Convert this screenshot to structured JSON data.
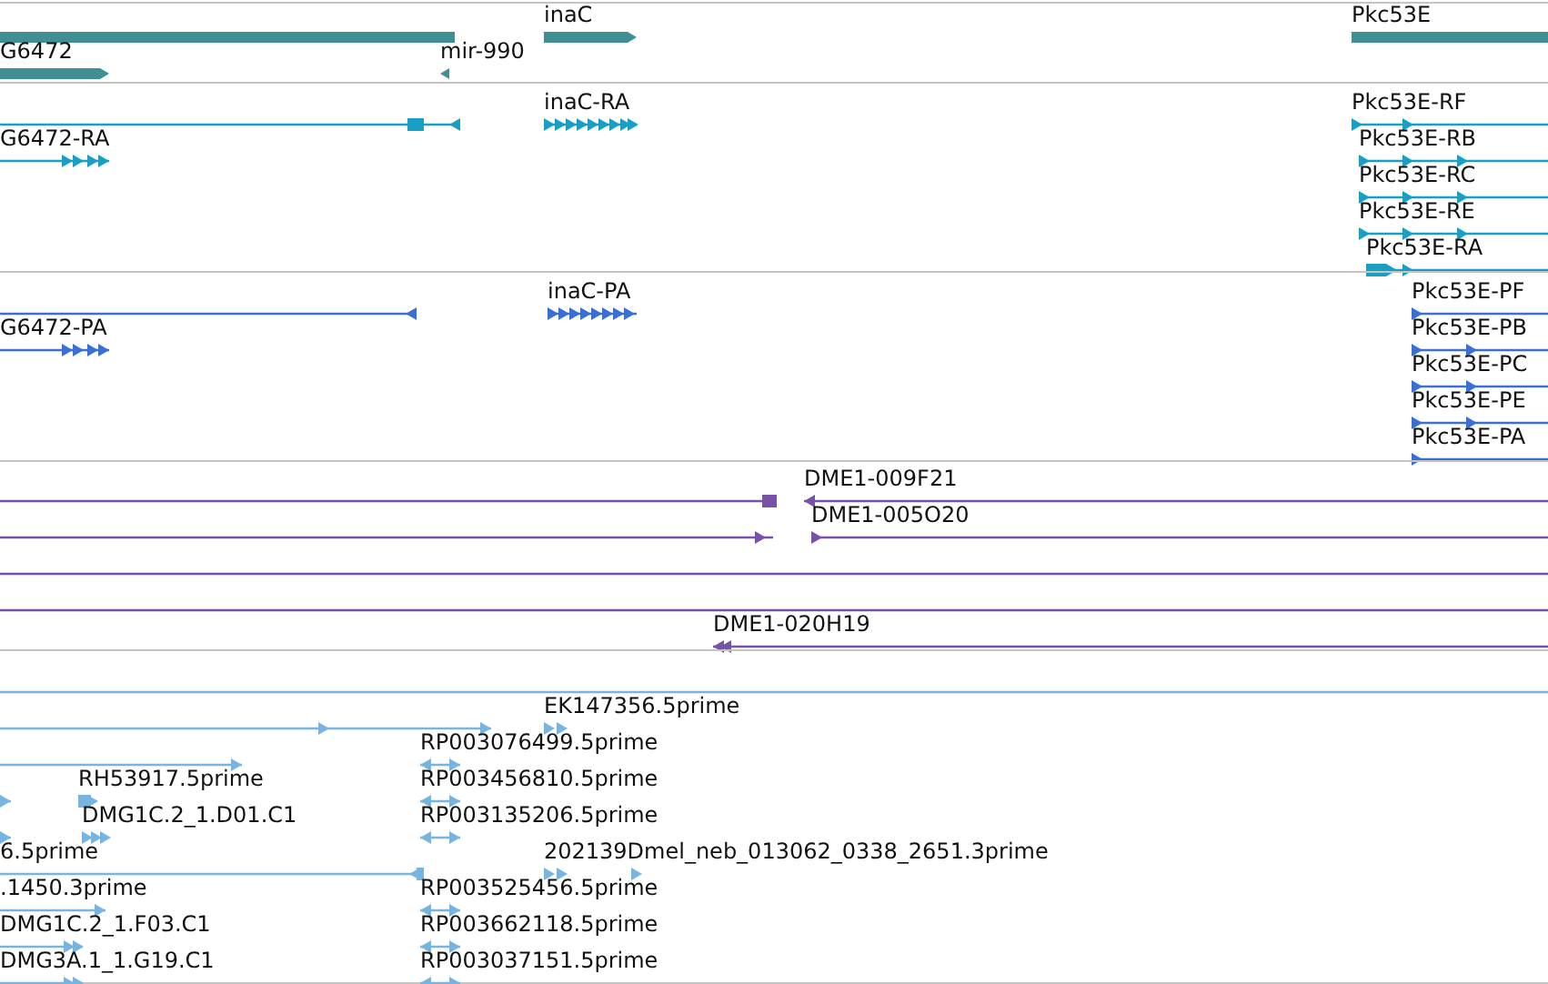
{
  "tracks": [
    {
      "kind": "gene",
      "color": "#3f8f93",
      "features": [
        {
          "reverse": true
        },
        {
          "label": "G6472",
          "reverse": false
        },
        {
          "label": "inaC",
          "reverse": false
        },
        {
          "label": "mir-990",
          "reverse": true
        },
        {
          "label": "Pkc53E",
          "reverse": false
        }
      ]
    },
    {
      "kind": "transcript",
      "color": "#1a9ec4",
      "features": [
        {
          "reverse": true
        },
        {
          "label": "G6472-RA",
          "reverse": false
        },
        {
          "label": "inaC-RA",
          "reverse": false
        },
        {
          "label": "Pkc53E-RF",
          "reverse": false
        },
        {
          "label": "Pkc53E-RB",
          "reverse": false
        },
        {
          "label": "Pkc53E-RC",
          "reverse": false
        },
        {
          "label": "Pkc53E-RE",
          "reverse": false
        },
        {
          "label": "Pkc53E-RA",
          "reverse": false
        }
      ]
    },
    {
      "kind": "protein",
      "color": "#3a70d4",
      "features": [
        {
          "reverse": true
        },
        {
          "label": "G6472-PA",
          "reverse": false
        },
        {
          "label": "inaC-PA",
          "reverse": false
        },
        {
          "label": "Pkc53E-PF",
          "reverse": false
        },
        {
          "label": "Pkc53E-PB",
          "reverse": false
        },
        {
          "label": "Pkc53E-PC",
          "reverse": false
        },
        {
          "label": "Pkc53E-PE",
          "reverse": false
        },
        {
          "label": "Pkc53E-PA",
          "reverse": false
        }
      ]
    },
    {
      "kind": "clone",
      "color": "#7752a8",
      "features": [
        {
          "paired": false
        },
        {
          "label": "DME1-009F21",
          "reverse": true,
          "paired": false
        },
        {
          "reverse": false,
          "paired": false
        },
        {
          "label": "DME1-005O20",
          "reverse": false,
          "paired": false
        },
        {
          "paired": false
        },
        {
          "paired": false
        },
        {
          "label": "DME1-020H19",
          "reverse": true,
          "paired": false
        }
      ]
    },
    {
      "kind": "est",
      "color": "#78b4e0",
      "features": [
        {
          "paired": false
        },
        {
          "reverse": false,
          "paired": false
        },
        {
          "label": "EK147356.5prime",
          "reverse": false,
          "paired": false
        },
        {
          "reverse": false,
          "paired": false
        },
        {
          "label": "RP003076499.5prime",
          "paired": true
        },
        {
          "reverse": false,
          "paired": false
        },
        {
          "label": "RH53917.5prime",
          "reverse": false,
          "paired": false
        },
        {
          "label": "RP003456810.5prime",
          "paired": true
        },
        {
          "reverse": false,
          "paired": false
        },
        {
          "label": "DMG1C.2_1.D01.C1",
          "reverse": false,
          "paired": false
        },
        {
          "label": "RP003135206.5prime",
          "paired": true
        },
        {
          "label": "6.5prime",
          "reverse": true,
          "paired": false
        },
        {
          "label": "202139Dmel_neb_013062_0338_2651.3prime",
          "reverse": false,
          "paired": false
        },
        {
          "label": ".1450.3prime",
          "reverse": false,
          "paired": false
        },
        {
          "label": "RP003525456.5prime",
          "paired": true
        },
        {
          "label": "DMG1C.2_1.F03.C1",
          "reverse": false,
          "paired": false
        },
        {
          "label": "RP003662118.5prime",
          "paired": true
        },
        {
          "label": "DMG3A.1_1.G19.C1",
          "reverse": false,
          "paired": false
        },
        {
          "label": "RP003037151.5prime",
          "paired": true
        }
      ]
    }
  ]
}
